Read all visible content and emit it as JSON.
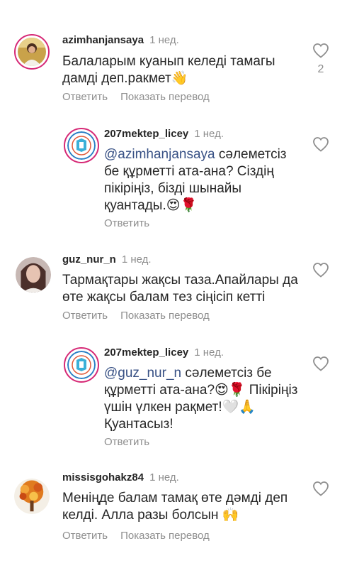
{
  "comments": [
    {
      "username": "azimhanjansaya",
      "time": "1 нед.",
      "text": "Балаларым куанып келеді тамагы дамді деп.ракмет👋",
      "reply_label": "Ответить",
      "translate_label": "Показать перевод",
      "like_count": "2",
      "avatar_icon": "user-photo-avatar-icon"
    },
    {
      "username": "207mektep_licey",
      "time": "1 нед.",
      "mention": "@azimhanjansaya",
      "text": " сәлеметсіз бе құрметті ата-ана? Сіздің пікіріңіз, бізді шынайы қуантады.😍🌹",
      "reply_label": "Ответить",
      "avatar_icon": "school-logo-avatar-icon"
    },
    {
      "username": "guz_nur_n",
      "time": "1 нед.",
      "text": "Тармақтары жақсы таза.Апайлары да өте жақсы балам тез сіңісіп кетті",
      "reply_label": "Ответить",
      "translate_label": "Показать перевод",
      "avatar_icon": "user-photo-avatar-icon"
    },
    {
      "username": "207mektep_licey",
      "time": "1 нед.",
      "mention": "@guz_nur_n",
      "text": " сәлеметсіз бе құрметті ата-ана?😍🌹 Пікіріңіз үшін үлкен рақмет!🤍🙏 Қуантасыз!",
      "reply_label": "Ответить",
      "avatar_icon": "school-logo-avatar-icon"
    },
    {
      "username": "missisgohakz84",
      "time": "1 нед.",
      "text": "Менiңде балам тамақ өте дәмді деп келді. Алла разы болсын 🙌",
      "reply_label": "Ответить",
      "translate_label": "Показать перевод",
      "avatar_icon": "autumn-tree-avatar-icon"
    }
  ],
  "colors": {
    "username": "#262626",
    "secondary": "#8e8e8e",
    "mention": "#385185",
    "story_ring": "#d62976"
  }
}
